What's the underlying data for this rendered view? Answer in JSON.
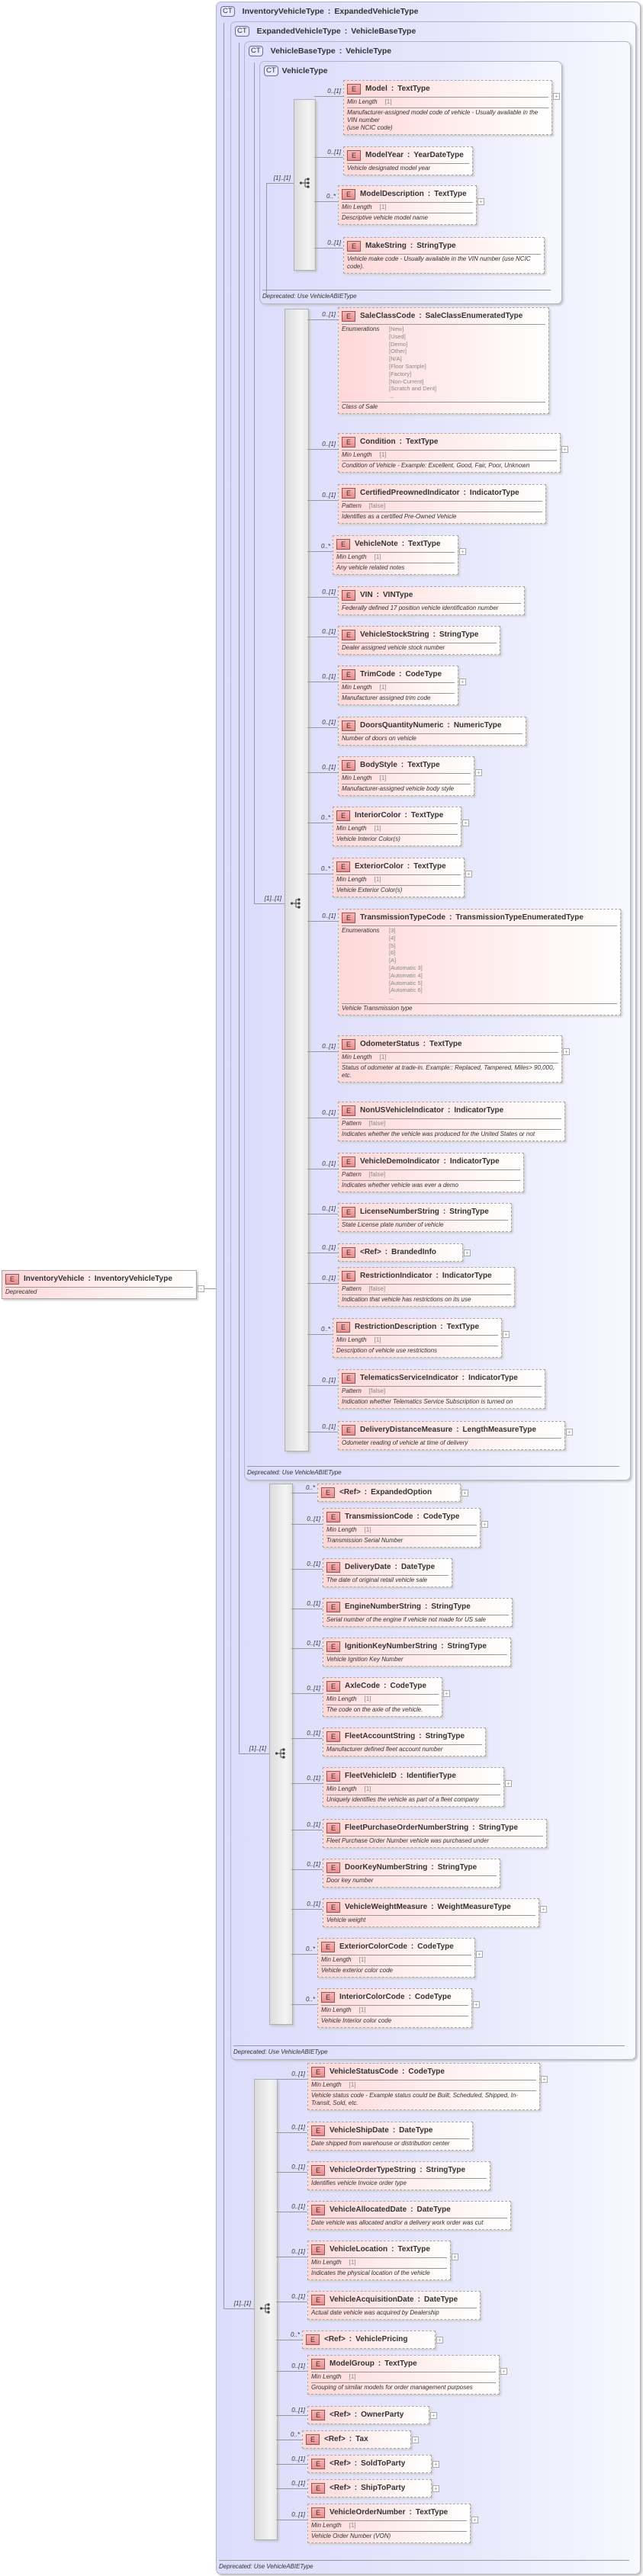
{
  "root_element": {
    "badge": "E",
    "name": "InventoryVehicle",
    "type": "InventoryVehicleType",
    "description": "Deprecated",
    "collapse_icon": "minus-icon"
  },
  "frames": [
    {
      "badge": "CT",
      "title": "InventoryVehicleType",
      "extends": "ExpandedVehicleType",
      "note": "Deprecated: Use VehicleABIEType"
    },
    {
      "badge": "CT",
      "title": "ExpandedVehicleType",
      "extends": "VehicleBaseType",
      "note": "Deprecated: Use VehicleABIEType"
    },
    {
      "badge": "CT",
      "title": "VehicleBaseType",
      "extends": "VehicleType",
      "note": "Deprecated: Use VehicleABIEType"
    },
    {
      "badge": "CT",
      "title": "VehicleType",
      "extends": "",
      "note": "Deprecated: Use VehicleABIEType"
    }
  ],
  "colors": {
    "frame_bg": "#dcdcfc",
    "element_bg": "#ffd8d8",
    "badge": "#ec8c8c"
  },
  "sequences": [
    {
      "owner": "VehicleType",
      "multiplicity": "[1]..[1]",
      "icon": "sequence-icon",
      "elements": [
        {
          "mult": "0..[1]",
          "name": "Model",
          "type": "TextType",
          "facet": {
            "label": "Min Length",
            "value": "[1]"
          },
          "description": "Manufacturer-assigned model code of vehicle - Usually available in the VIN number\n(use NCIC code)",
          "expandable": true
        },
        {
          "mult": "0..[1]",
          "name": "ModelYear",
          "type": "YearDateType",
          "description": "Vehicle designated model year",
          "expandable": false
        },
        {
          "mult": "0..*",
          "name": "ModelDescription",
          "type": "TextType",
          "facet": {
            "label": "Min Length",
            "value": "[1]"
          },
          "description": "Descriptive vehicle model name",
          "expandable": true
        },
        {
          "mult": "0..[1]",
          "name": "MakeString",
          "type": "StringType",
          "description": "Vehicle make code - Usually available in the VIN number (use NCIC code).",
          "expandable": false
        }
      ]
    },
    {
      "owner": "VehicleBaseType",
      "multiplicity": "[1]..[1]",
      "icon": "sequence-icon",
      "elements": [
        {
          "mult": "0..[1]",
          "name": "SaleClassCode",
          "type": "SaleClassEnumeratedType",
          "enumerations": {
            "label": "Enumerations",
            "values": [
              "[New]",
              "[Used]",
              "[Demo]",
              "[Other]",
              "[N/A]",
              "[Floor Sample]",
              "[Factory]",
              "[Non-Current]",
              "[Scratch and Dent]",
              "..."
            ]
          },
          "description": "Class of Sale",
          "expandable": false
        },
        {
          "mult": "0..[1]",
          "name": "Condition",
          "type": "TextType",
          "facet": {
            "label": "Min Length",
            "value": "[1]"
          },
          "description": "Condition of Vehicle - Example: Excellent, Good, Fair, Poor, Unknown",
          "expandable": true
        },
        {
          "mult": "0..[1]",
          "name": "CertifiedPreownedIndicator",
          "type": "IndicatorType",
          "facet": {
            "label": "Pattern",
            "value": "[false]"
          },
          "description": "Identifies as a certified Pre-Owned Vehicle",
          "expandable": false
        },
        {
          "mult": "0..*",
          "name": "VehicleNote",
          "type": "TextType",
          "facet": {
            "label": "Min Length",
            "value": "[1]"
          },
          "description": "Any vehicle related notes",
          "expandable": true
        },
        {
          "mult": "0..[1]",
          "name": "VIN",
          "type": "VINType",
          "description": "Federally defined 17 position vehicle identification number",
          "expandable": false
        },
        {
          "mult": "0..[1]",
          "name": "VehicleStockString",
          "type": "StringType",
          "description": "Dealer assigned vehicle stock number",
          "expandable": false
        },
        {
          "mult": "0..[1]",
          "name": "TrimCode",
          "type": "CodeType",
          "facet": {
            "label": "Min Length",
            "value": "[1]"
          },
          "description": "Manufacturer assigned trim code",
          "expandable": true
        },
        {
          "mult": "0..[1]",
          "name": "DoorsQuantityNumeric",
          "type": "NumericType",
          "description": "Number of doors on vehicle",
          "expandable": false
        },
        {
          "mult": "0..[1]",
          "name": "BodyStyle",
          "type": "TextType",
          "facet": {
            "label": "Min Length",
            "value": "[1]"
          },
          "description": "Manufacturer-assigned vehicle body style",
          "expandable": true
        },
        {
          "mult": "0..*",
          "name": "InteriorColor",
          "type": "TextType",
          "facet": {
            "label": "Min Length",
            "value": "[1]"
          },
          "description": "Vehicle Interior Color(s)",
          "expandable": true
        },
        {
          "mult": "0..*",
          "name": "ExteriorColor",
          "type": "TextType",
          "facet": {
            "label": "Min Length",
            "value": "[1]"
          },
          "description": "Vehicle Exterior Color(s)",
          "expandable": true
        },
        {
          "mult": "0..[1]",
          "name": "TransmissionTypeCode",
          "type": "TransmissionTypeEnumeratedType",
          "enumerations": {
            "label": "Enumerations",
            "values": [
              "[3]",
              "[4]",
              "[5]",
              "[6]",
              "[A]",
              "[Automatic 3]",
              "[Automatic 4]",
              "[Automatic 5]",
              "[Automatic 6]",
              "..."
            ]
          },
          "description": "Vehicle Transmission type",
          "expandable": false
        },
        {
          "mult": "0..[1]",
          "name": "OdometerStatus",
          "type": "TextType",
          "facet": {
            "label": "Min Length",
            "value": "[1]"
          },
          "description": "Status of odometer at trade-in. Example:: Replaced, Tampered, Miles> 90,000,\netc.",
          "expandable": true
        },
        {
          "mult": "0..[1]",
          "name": "NonUSVehicleIndicator",
          "type": "IndicatorType",
          "facet": {
            "label": "Pattern",
            "value": "[false]"
          },
          "description": "Indicates whether the vehicle was produced for the United States or not",
          "expandable": false
        },
        {
          "mult": "0..[1]",
          "name": "VehicleDemoIndicator",
          "type": "IndicatorType",
          "facet": {
            "label": "Pattern",
            "value": "[false]"
          },
          "description": "Indicates whether vehicle was ever a demo",
          "expandable": false
        },
        {
          "mult": "0..[1]",
          "name": "LicenseNumberString",
          "type": "StringType",
          "description": "State License plate number of vehicle",
          "expandable": false
        },
        {
          "mult": "0..[1]",
          "name": "<Ref>",
          "type": "BrandedInfo",
          "expandable": true
        },
        {
          "mult": "0..[1]",
          "name": "RestrictionIndicator",
          "type": "IndicatorType",
          "facet": {
            "label": "Pattern",
            "value": "[false]"
          },
          "description": "Indication that vehicle has restrictions on its use",
          "expandable": false
        },
        {
          "mult": "0..*",
          "name": "RestrictionDescription",
          "type": "TextType",
          "facet": {
            "label": "Min Length",
            "value": "[1]"
          },
          "description": "Description of vehicle use restrictions",
          "expandable": true
        },
        {
          "mult": "0..[1]",
          "name": "TelematicsServiceIndicator",
          "type": "IndicatorType",
          "facet": {
            "label": "Pattern",
            "value": "[false]"
          },
          "description": "Indication whether Telematics Service Subscription is turned on",
          "expandable": false
        },
        {
          "mult": "0..[1]",
          "name": "DeliveryDistanceMeasure",
          "type": "LengthMeasureType",
          "description": "Odometer reading of vehicle at time of delivery",
          "expandable": true
        }
      ]
    },
    {
      "owner": "ExpandedVehicleType",
      "multiplicity": "[1]..[1]",
      "icon": "sequence-icon",
      "elements": [
        {
          "mult": "0..*",
          "name": "<Ref>",
          "type": "ExpandedOption",
          "expandable": true
        },
        {
          "mult": "0..[1]",
          "name": "TransmissionCode",
          "type": "CodeType",
          "facet": {
            "label": "Min Length",
            "value": "[1]"
          },
          "description": "Transmission Serial Number",
          "expandable": true
        },
        {
          "mult": "0..[1]",
          "name": "DeliveryDate",
          "type": "DateType",
          "description": "The date of original retail vehicle sale",
          "expandable": false
        },
        {
          "mult": "0..[1]",
          "name": "EngineNumberString",
          "type": "StringType",
          "description": "Serial number of the engine if vehicle not made for US sale",
          "expandable": false
        },
        {
          "mult": "0..[1]",
          "name": "IgnitionKeyNumberString",
          "type": "StringType",
          "description": "Vehicle Ignition Key Number",
          "expandable": false
        },
        {
          "mult": "0..[1]",
          "name": "AxleCode",
          "type": "CodeType",
          "facet": {
            "label": "Min Length",
            "value": "[1]"
          },
          "description": "The code on the axle of the vehicle.",
          "expandable": true
        },
        {
          "mult": "0..[1]",
          "name": "FleetAccountString",
          "type": "StringType",
          "description": "Manufacturer defined fleet account number",
          "expandable": false
        },
        {
          "mult": "0..[1]",
          "name": "FleetVehicleID",
          "type": "IdentifierType",
          "facet": {
            "label": "Min Length",
            "value": "[1]"
          },
          "description": "Uniquely identifies the vehicle as part of a fleet company",
          "expandable": true
        },
        {
          "mult": "0..[1]",
          "name": "FleetPurchaseOrderNumberString",
          "type": "StringType",
          "description": "Fleet Purchase Order Number vehicle was purchased under",
          "expandable": false
        },
        {
          "mult": "0..[1]",
          "name": "DoorKeyNumberString",
          "type": "StringType",
          "description": "Door key number",
          "expandable": false
        },
        {
          "mult": "0..[1]",
          "name": "VehicleWeightMeasure",
          "type": "WeightMeasureType",
          "description": "Vehicle weight",
          "expandable": true
        },
        {
          "mult": "0..*",
          "name": "ExteriorColorCode",
          "type": "CodeType",
          "facet": {
            "label": "Min Length",
            "value": "[1]"
          },
          "description": "Vehicle exterior color code",
          "expandable": true
        },
        {
          "mult": "0..*",
          "name": "InteriorColorCode",
          "type": "CodeType",
          "facet": {
            "label": "Min Length",
            "value": "[1]"
          },
          "description": "Vehicle Interior color code",
          "expandable": true
        }
      ]
    },
    {
      "owner": "InventoryVehicleType",
      "multiplicity": "[1]..[1]",
      "icon": "sequence-icon",
      "elements": [
        {
          "mult": "0..[1]",
          "name": "VehicleStatusCode",
          "type": "CodeType",
          "facet": {
            "label": "Min Length",
            "value": "[1]"
          },
          "description": "Vehicle status code - Example status could be Built, Scheduled, Shipped, In-Transit, Sold, etc.",
          "expandable": true
        },
        {
          "mult": "0..[1]",
          "name": "VehicleShipDate",
          "type": "DateType",
          "description": "Date shipped from warehouse or distribution center",
          "expandable": false
        },
        {
          "mult": "0..[1]",
          "name": "VehicleOrderTypeString",
          "type": "StringType",
          "description": "Identifies vehicle Invoice order type",
          "expandable": false
        },
        {
          "mult": "0..[1]",
          "name": "VehicleAllocatedDate",
          "type": "DateType",
          "description": "Date vehicle was allocated and/or a delivery work order was cut",
          "expandable": false
        },
        {
          "mult": "0..[1]",
          "name": "VehicleLocation",
          "type": "TextType",
          "facet": {
            "label": "Min Length",
            "value": "[1]"
          },
          "description": "Indicates the physical location of the vehicle",
          "expandable": true
        },
        {
          "mult": "0..[1]",
          "name": "VehicleAcquisitionDate",
          "type": "DateType",
          "description": "Actual date vehicle was acquired by Dealership",
          "expandable": false
        },
        {
          "mult": "0..*",
          "name": "<Ref>",
          "type": "VehiclePricing",
          "expandable": true
        },
        {
          "mult": "0..[1]",
          "name": "ModelGroup",
          "type": "TextType",
          "facet": {
            "label": "Min Length",
            "value": "[1]"
          },
          "description": "Grouping of similar models for order management purposes",
          "expandable": true
        },
        {
          "mult": "0..[1]",
          "name": "<Ref>",
          "type": "OwnerParty",
          "expandable": true
        },
        {
          "mult": "0..*",
          "name": "<Ref>",
          "type": "Tax",
          "expandable": true
        },
        {
          "mult": "0..[1]",
          "name": "<Ref>",
          "type": "SoldToParty",
          "expandable": true
        },
        {
          "mult": "0..[1]",
          "name": "<Ref>",
          "type": "ShipToParty",
          "expandable": true
        },
        {
          "mult": "0..[1]",
          "name": "VehicleOrderNumber",
          "type": "TextType",
          "facet": {
            "label": "Min Length",
            "value": "[1]"
          },
          "description": "Vehicle Order Number (VON)",
          "expandable": true
        }
      ]
    }
  ]
}
